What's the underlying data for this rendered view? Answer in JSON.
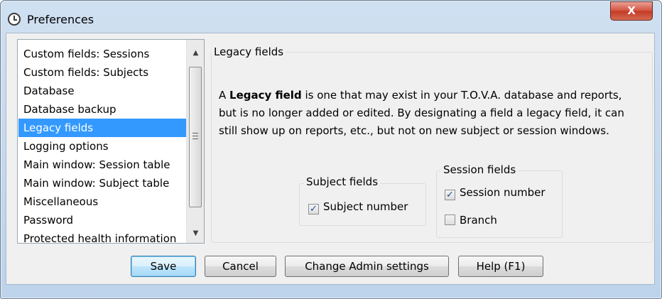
{
  "window": {
    "title": "Preferences",
    "close_glyph": "X",
    "icon": "app-clock-icon"
  },
  "sidebar": {
    "selected_index": 4,
    "items": [
      {
        "label": "Custom fields: Sessions"
      },
      {
        "label": "Custom fields: Subjects"
      },
      {
        "label": "Database"
      },
      {
        "label": "Database backup"
      },
      {
        "label": "Legacy fields"
      },
      {
        "label": "Logging options"
      },
      {
        "label": "Main window: Session table"
      },
      {
        "label": "Main window: Subject table"
      },
      {
        "label": "Miscellaneous"
      },
      {
        "label": "Password"
      },
      {
        "label": "Protected health information"
      }
    ],
    "scroll_up_glyph": "▲",
    "scroll_down_glyph": "▼"
  },
  "panel": {
    "title": "Legacy fields",
    "description": {
      "line1_prefix": "A ",
      "line1_bold": "Legacy field",
      "line1_suffix": " is one that may exist in your T.O.V.A. database and reports,",
      "line2": "but is no longer added or edited. By designating a field a legacy field, it can",
      "line3": "still show up on reports, etc., but not on new subject or session windows."
    },
    "subject_fields": {
      "title": "Subject fields",
      "items": [
        {
          "label": "Subject number",
          "checked": true
        }
      ]
    },
    "session_fields": {
      "title": "Session fields",
      "items": [
        {
          "label": "Session number",
          "checked": true
        },
        {
          "label": "Branch",
          "checked": false
        }
      ]
    },
    "check_glyph": "✓"
  },
  "buttons": {
    "save": "Save",
    "cancel": "Cancel",
    "change_admin": "Change Admin settings",
    "help": "Help (F1)"
  },
  "colors": {
    "selection": "#3399ff",
    "close_button": "#c23a25",
    "frame": "#bdd3eb"
  }
}
